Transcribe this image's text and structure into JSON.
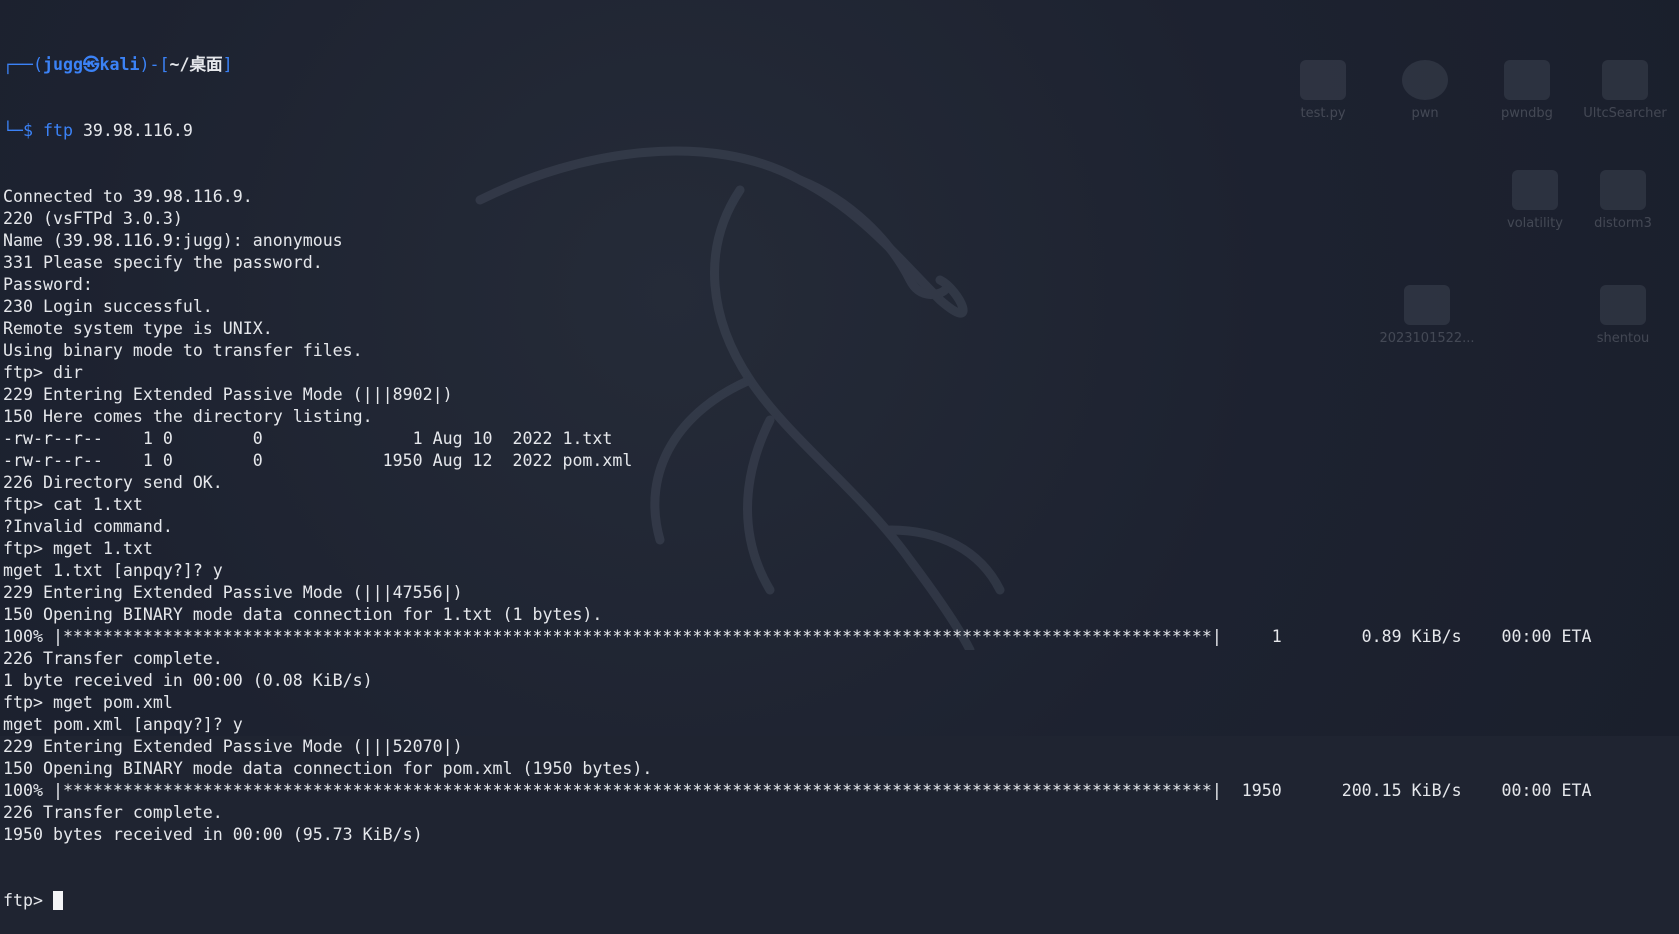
{
  "desktop": {
    "icons": [
      {
        "name": "test.py",
        "glyph": "python-file-icon"
      },
      {
        "name": "pwn",
        "glyph": "gear-icon"
      },
      {
        "name": "pwndbg",
        "glyph": "locked-folder-icon"
      },
      {
        "name": "UltcSearcher",
        "glyph": "folder-icon"
      },
      {
        "name": "volatility",
        "glyph": "folder-icon"
      },
      {
        "name": "distorm3",
        "glyph": "folder-icon"
      },
      {
        "name": "2023101522...",
        "glyph": "archive-file-icon"
      },
      {
        "name": "shentou",
        "glyph": "folder-icon"
      }
    ]
  },
  "terminal": {
    "prompt": {
      "open": "┌──(",
      "user": "jugg㉿kali",
      "mid": ")-[",
      "dir": "~/桌面",
      "close": "]",
      "line2_prefix": "└─$ ",
      "command_name": "ftp",
      "command_args": " 39.98.116.9"
    },
    "lines": [
      "Connected to 39.98.116.9.",
      "220 (vsFTPd 3.0.3)",
      "Name (39.98.116.9:jugg): anonymous",
      "331 Please specify the password.",
      "Password:",
      "230 Login successful.",
      "Remote system type is UNIX.",
      "Using binary mode to transfer files.",
      "ftp> dir",
      "229 Entering Extended Passive Mode (|||8902|)",
      "150 Here comes the directory listing.",
      "-rw-r--r--    1 0        0               1 Aug 10  2022 1.txt",
      "-rw-r--r--    1 0        0            1950 Aug 12  2022 pom.xml",
      "226 Directory send OK.",
      "ftp> cat 1.txt",
      "?Invalid command.",
      "ftp> mget 1.txt",
      "mget 1.txt [anpqy?]? y",
      "229 Entering Extended Passive Mode (|||47556|)",
      "150 Opening BINARY mode data connection for 1.txt (1 bytes).",
      "100% |*******************************************************************************************************************|     1        0.89 KiB/s    00:00 ETA",
      "226 Transfer complete.",
      "1 byte received in 00:00 (0.08 KiB/s)",
      "ftp> mget pom.xml",
      "mget pom.xml [anpqy?]? y",
      "229 Entering Extended Passive Mode (|||52070|)",
      "150 Opening BINARY mode data connection for pom.xml (1950 bytes).",
      "100% |*******************************************************************************************************************|  1950      200.15 KiB/s    00:00 ETA",
      "226 Transfer complete.",
      "1950 bytes received in 00:00 (95.73 KiB/s)"
    ],
    "final_prompt": "ftp> "
  }
}
